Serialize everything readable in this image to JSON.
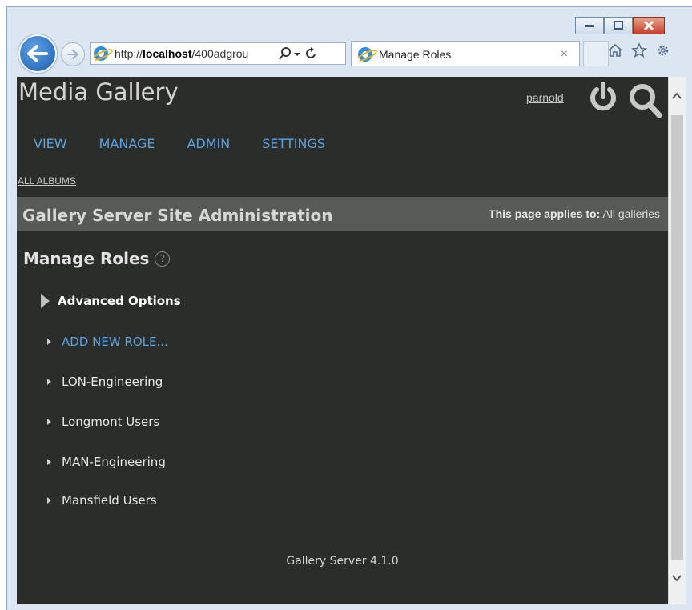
{
  "browser": {
    "url_prefix": "http://",
    "url_host": "localhost",
    "url_path": "/400adgrou",
    "tab_title": "Manage Roles",
    "tab_close": "×"
  },
  "header": {
    "title": "Media Gallery",
    "username": "parnold"
  },
  "nav": {
    "items": [
      "VIEW",
      "MANAGE",
      "ADMIN",
      "SETTINGS"
    ],
    "breadcrumb": "ALL ALBUMS"
  },
  "admin_bar": {
    "title": "Gallery Server Site Administration",
    "applies_label": "This page applies to:",
    "applies_value": "All galleries"
  },
  "main": {
    "heading": "Manage Roles",
    "help_symbol": "?",
    "advanced_options": "Advanced Options",
    "roles": [
      "ADD NEW ROLE...",
      "LON-Engineering",
      "Longmont Users",
      "MAN-Engineering",
      "Mansfield Users"
    ]
  },
  "footer": {
    "text": "Gallery Server 4.1.0"
  },
  "colors": {
    "page_bg": "#2b2d2a",
    "admin_bar_bg": "#585a57",
    "link_blue": "#5aa1e0",
    "chrome_frame": "#dbe6f2"
  }
}
